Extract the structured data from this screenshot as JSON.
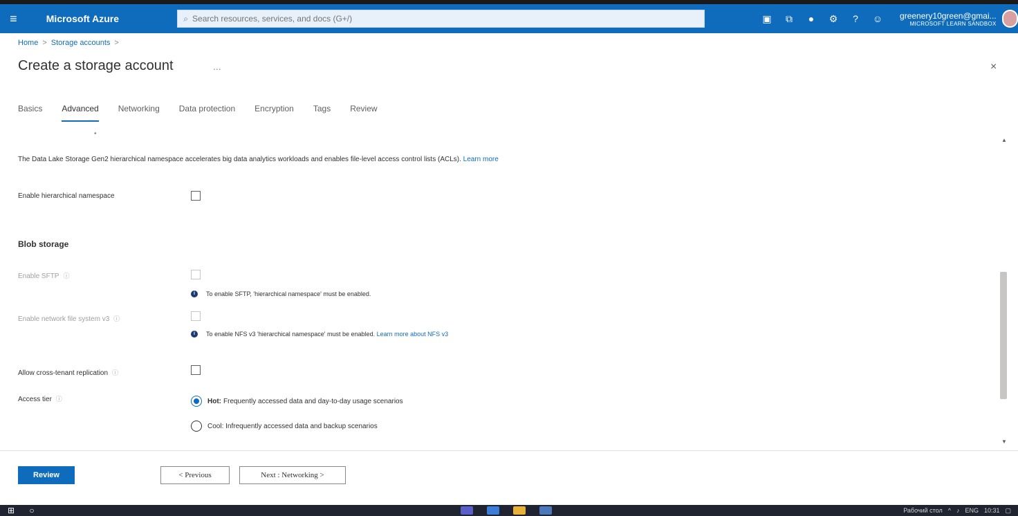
{
  "topbar": {
    "menu_icon": "hamburger-icon",
    "brand": "Microsoft Azure",
    "search_placeholder": "Search resources, services, and docs (G+/)",
    "icons": [
      "cloud-shell-icon",
      "directory-filter-icon",
      "notifications-icon",
      "settings-icon",
      "help-icon",
      "feedback-icon"
    ],
    "account_email": "greenery10green@gmai...",
    "account_tenant": "MICROSOFT LEARN SANDBOX"
  },
  "breadcrumb": {
    "items": [
      "Home",
      "Storage accounts"
    ],
    "separator": ">"
  },
  "page": {
    "title": "Create a storage account",
    "more_label": "...",
    "close_label": "×"
  },
  "tabs": [
    {
      "label": "Basics",
      "active": false
    },
    {
      "label": "Advanced",
      "active": true
    },
    {
      "label": "Networking",
      "active": false
    },
    {
      "label": "Data protection",
      "active": false
    },
    {
      "label": "Encryption",
      "active": false
    },
    {
      "label": "Tags",
      "active": false
    },
    {
      "label": "Review",
      "active": false
    }
  ],
  "content": {
    "intro_text": "The Data Lake Storage Gen2 hierarchical namespace accelerates big data analytics workloads and enables file-level access control lists (ACLs).",
    "intro_link": "Learn more",
    "hierarchical_label": "Enable hierarchical namespace",
    "blob_section_title": "Blob storage",
    "sftp_label": "Enable SFTP",
    "sftp_info": "To enable SFTP, 'hierarchical namespace' must be enabled.",
    "nfs_label": "Enable network file system v3",
    "nfs_info": "To enable NFS v3 'hierarchical namespace' must be enabled.",
    "nfs_info_link": "Learn more about NFS v3",
    "cross_tenant_label": "Allow cross-tenant replication",
    "access_tier_label": "Access tier",
    "access_tier_options": [
      {
        "name": "Hot:",
        "desc": "Frequently accessed data and day-to-day usage scenarios",
        "checked": true
      },
      {
        "name": "Cool:",
        "desc": "Infrequently accessed data and backup scenarios",
        "checked": false
      }
    ]
  },
  "footer": {
    "review_label": "Review",
    "previous_label": "< Previous",
    "next_label": "Next : Networking >"
  },
  "taskbar": {
    "desktop_label": "Рабочий стол",
    "lang": "ENG",
    "time": "10:31"
  },
  "colors": {
    "azure_blue": "#0f6cbd",
    "taskbar": "#1f2430"
  }
}
